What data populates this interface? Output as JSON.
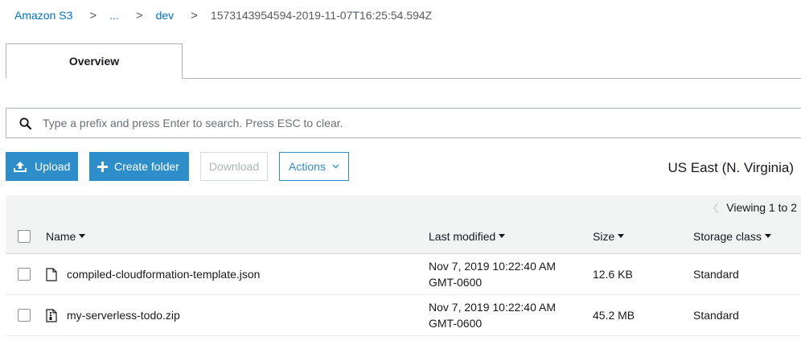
{
  "breadcrumb": {
    "root": "Amazon S3",
    "ellipsis": "...",
    "folder": "dev",
    "current": "1573143954594-2019-11-07T16:25:54.594Z",
    "separator": ">"
  },
  "tabs": [
    {
      "label": "Overview"
    }
  ],
  "search": {
    "placeholder": "Type a prefix and press Enter to search. Press ESC to clear.",
    "icon": "search-icon"
  },
  "toolbar": {
    "upload_label": "Upload",
    "create_folder_label": "Create folder",
    "download_label": "Download",
    "actions_label": "Actions",
    "accent_color": "#2e8ec9"
  },
  "region": "US East (N. Virginia)",
  "pagination": {
    "viewing": "Viewing 1 to 2"
  },
  "table": {
    "columns": [
      "Name",
      "Last modified",
      "Size",
      "Storage class"
    ],
    "rows": [
      {
        "name": "compiled-cloudformation-template.json",
        "icon": "file-icon",
        "modified_line1": "Nov 7, 2019 10:22:40 AM",
        "modified_line2": "GMT-0600",
        "size": "12.6 KB",
        "storage_class": "Standard"
      },
      {
        "name": "my-serverless-todo.zip",
        "icon": "zip-file-icon",
        "modified_line1": "Nov 7, 2019 10:22:40 AM",
        "modified_line2": "GMT-0600",
        "size": "45.2 MB",
        "storage_class": "Standard"
      }
    ]
  }
}
